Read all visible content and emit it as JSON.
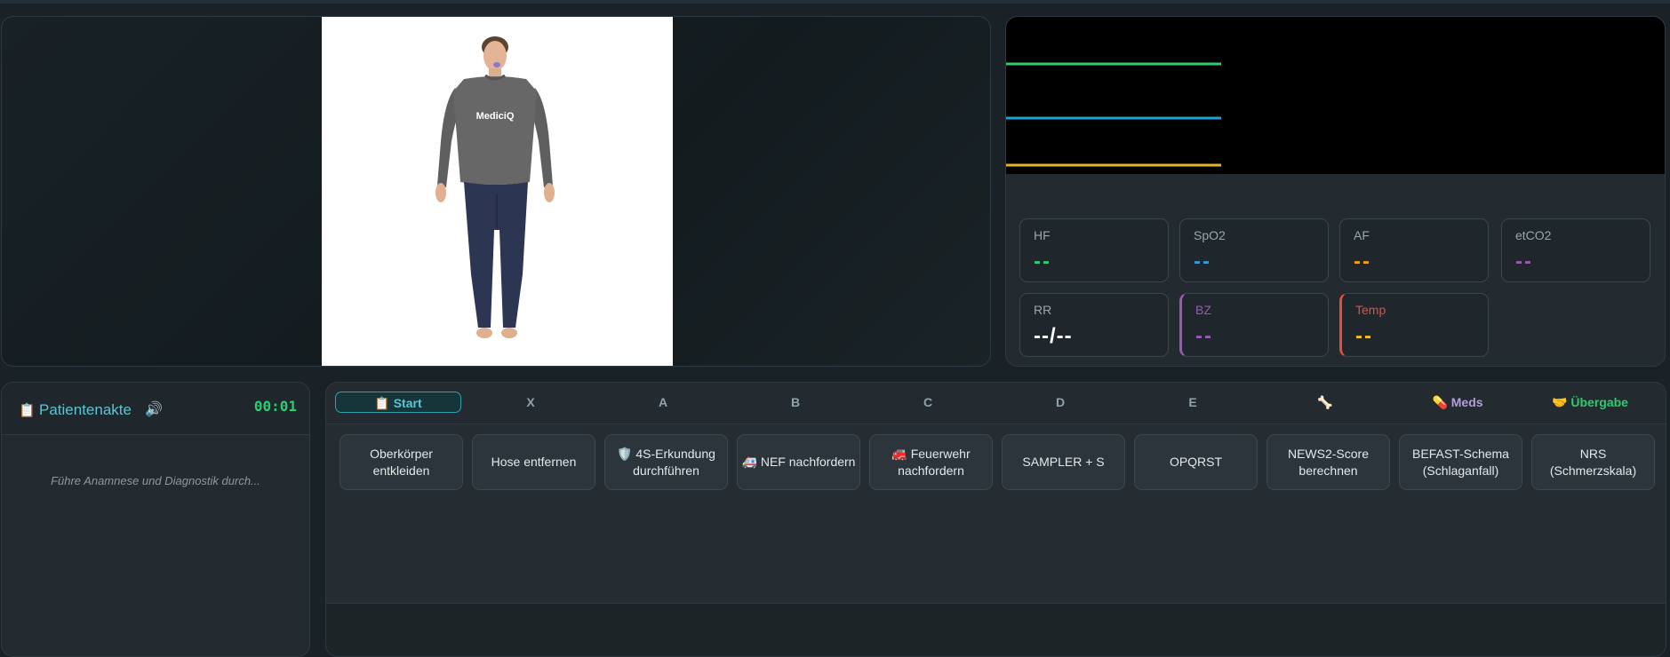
{
  "avatar": {
    "shirt_text": "MediciQ"
  },
  "monitor": {
    "wave_colors": [
      "#2ecc71",
      "#1fa3d6",
      "#e6b422"
    ],
    "vitals": [
      {
        "label": "HF",
        "value": "--",
        "color": "#2ecc71"
      },
      {
        "label": "SpO2",
        "value": "--",
        "color": "#3498db"
      },
      {
        "label": "AF",
        "value": "--",
        "color": "#f39c12"
      },
      {
        "label": "etCO2",
        "value": "--",
        "color": "#9b59b6"
      },
      {
        "label": "RR",
        "value": "--/--",
        "color": "#ffffff"
      },
      {
        "label": "BZ",
        "value": "--",
        "color": "#9b59b6"
      },
      {
        "label": "Temp",
        "value": "--",
        "color": "#f1c40f"
      }
    ]
  },
  "record": {
    "icon": "clipboard-icon",
    "title": "Patientenakte",
    "timer": "00:01",
    "hint": "Führe Anamnese und Diagnostik durch..."
  },
  "tabs": [
    {
      "label": "📋 Start"
    },
    {
      "label": "X"
    },
    {
      "label": "A"
    },
    {
      "label": "B"
    },
    {
      "label": "C"
    },
    {
      "label": "D"
    },
    {
      "label": "E"
    },
    {
      "label": "🦴"
    },
    {
      "label": "💊 Meds"
    },
    {
      "label": "🤝 Übergabe"
    }
  ],
  "actions": [
    {
      "label": "Oberkörper entkleiden"
    },
    {
      "label": "Hose entfernen"
    },
    {
      "label": "🛡️ 4S-Erkundung durchführen"
    },
    {
      "label": "🚑 NEF nachfordern"
    },
    {
      "label": "🚒 Feuerwehr nachfordern"
    },
    {
      "label": "SAMPLER + S"
    },
    {
      "label": "OPQRST"
    },
    {
      "label": "NEWS2-Score berechnen"
    },
    {
      "label": "BEFAST-Schema (Schlaganfall)"
    },
    {
      "label": "NRS (Schmerzskala)"
    }
  ]
}
